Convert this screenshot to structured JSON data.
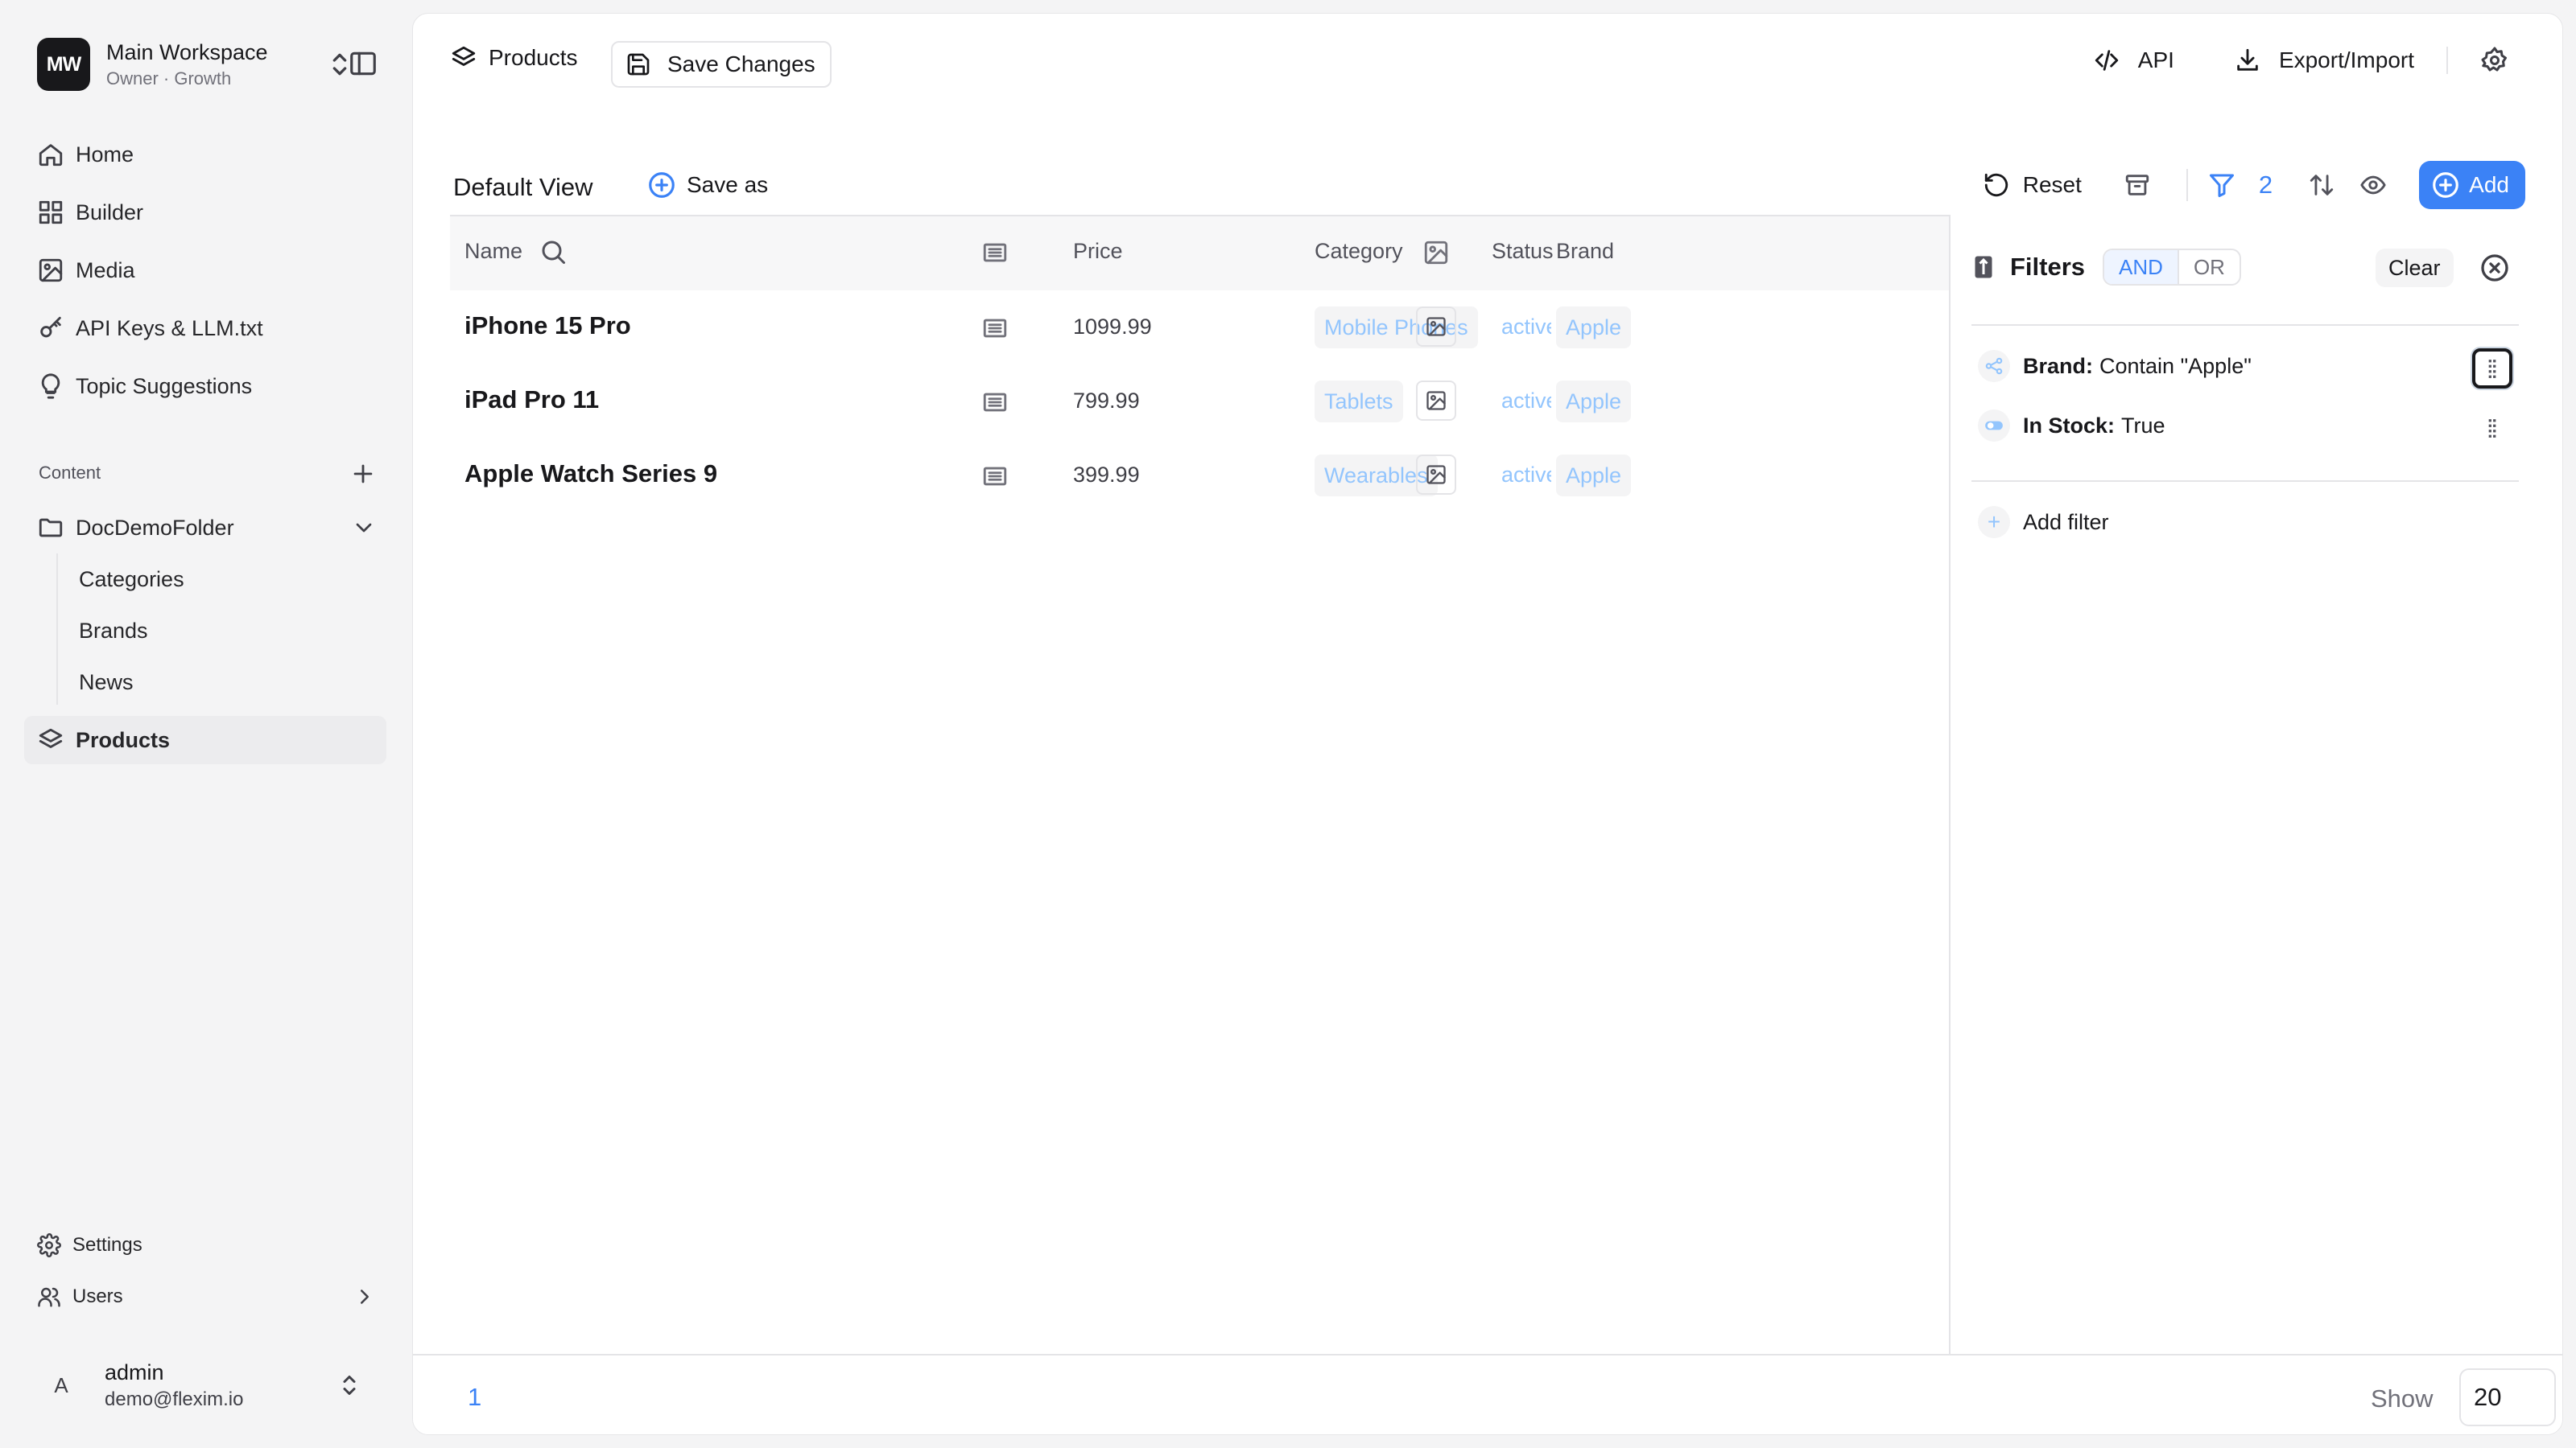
{
  "workspace": {
    "logo": "MW",
    "name": "Main Workspace",
    "subtitle": "Owner · Growth"
  },
  "nav": {
    "home": "Home",
    "builder": "Builder",
    "media": "Media",
    "api_keys": "API Keys & LLM.txt",
    "topics": "Topic Suggestions",
    "content_label": "Content",
    "folder": "DocDemoFolder",
    "folder_items": [
      "Categories",
      "Brands",
      "News"
    ],
    "products": "Products",
    "settings": "Settings",
    "users": "Users"
  },
  "user": {
    "initial": "A",
    "name": "admin",
    "email": "demo@flexim.io"
  },
  "topbar": {
    "crumb": "Products",
    "save_label": "Save Changes",
    "api_label": "API",
    "export_label": "Export/Import"
  },
  "viewbar": {
    "view_name": "Default View",
    "save_as": "Save as",
    "reset": "Reset",
    "filter_count": "2",
    "add": "Add"
  },
  "table": {
    "columns": {
      "name": "Name",
      "price": "Price",
      "category": "Category",
      "brand": "Brand",
      "status": "Status"
    },
    "rows": [
      {
        "name": "iPhone 15 Pro",
        "price": "1099.99",
        "category": "Mobile Phones",
        "brand": "Apple",
        "status": "active"
      },
      {
        "name": "iPad Pro 11",
        "price": "799.99",
        "category": "Tablets",
        "brand": "Apple",
        "status": "active"
      },
      {
        "name": "Apple Watch Series 9",
        "price": "399.99",
        "category": "Wearables",
        "brand": "Apple",
        "status": "active"
      }
    ]
  },
  "filters": {
    "title": "Filters",
    "logic_and": "AND",
    "logic_or": "OR",
    "clear": "Clear",
    "rules": [
      {
        "field": "Brand:",
        "condition": "Contain \"Apple\""
      },
      {
        "field": "In Stock:",
        "condition": "True"
      }
    ],
    "add_filter": "Add filter"
  },
  "footer": {
    "page": "1",
    "show_label": "Show",
    "page_size": "20"
  },
  "colors": {
    "accent": "#3b82f6",
    "muted_link": "#93c5fd",
    "dark": "#18181b"
  }
}
